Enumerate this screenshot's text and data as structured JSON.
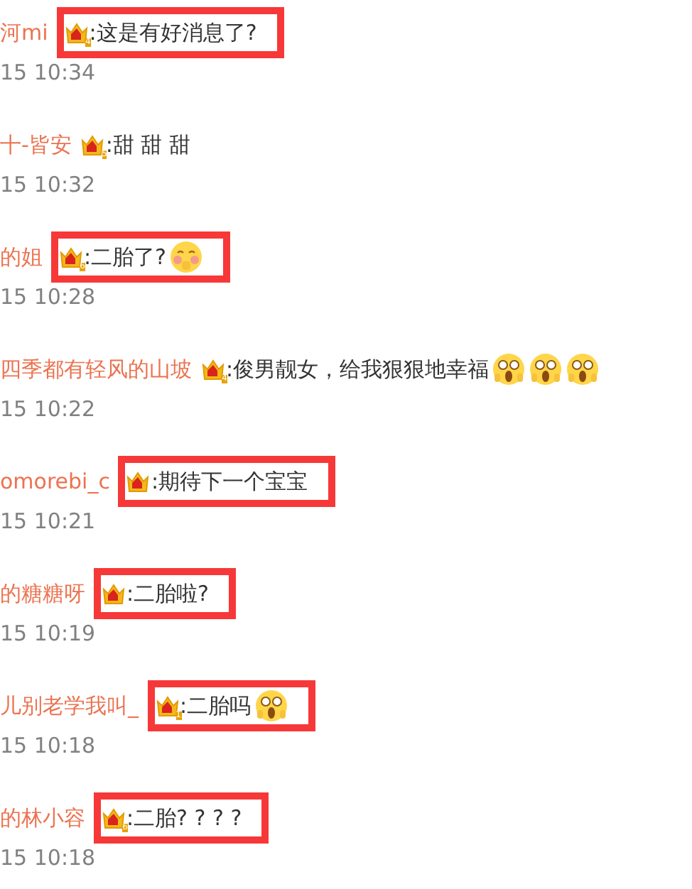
{
  "comments": [
    {
      "name": "河mi",
      "badge": "4",
      "text": ":这是有好消息了?",
      "time": "15 10:34",
      "highlighted": true
    },
    {
      "name": "十-皆安",
      "badge": "5",
      "text": ":甜 甜 甜",
      "time": "15 10:32",
      "highlighted": false
    },
    {
      "name": "的姐",
      "badge": "6",
      "text": ":二胎了?",
      "emojis": [
        {
          "kind": "blush"
        }
      ],
      "time": "15 10:28",
      "highlighted": true
    },
    {
      "name": "四季都有轻风的山坡",
      "badge": "4",
      "text": ":俊男靓女，给我狠狠地幸福",
      "emojis": [
        {
          "kind": "scared"
        },
        {
          "kind": "scared"
        },
        {
          "kind": "scared"
        }
      ],
      "time": "15 10:22",
      "highlighted": false
    },
    {
      "name": "omorebi_c",
      "text": ":期待下一个宝宝",
      "time": "15 10:21",
      "highlighted": true
    },
    {
      "name": "的糖糖呀",
      "text": ":二胎啦?",
      "time": "15 10:19",
      "highlighted": true
    },
    {
      "name": "儿别老学我叫_",
      "badge": "1",
      "text": ":二胎吗",
      "emojis": [
        {
          "kind": "scared"
        }
      ],
      "time": "15 10:18",
      "highlighted": true
    },
    {
      "name": "的林小容",
      "badge": "6",
      "text": ":二胎? ? ? ?",
      "time": "15 10:18",
      "highlighted": true
    }
  ]
}
